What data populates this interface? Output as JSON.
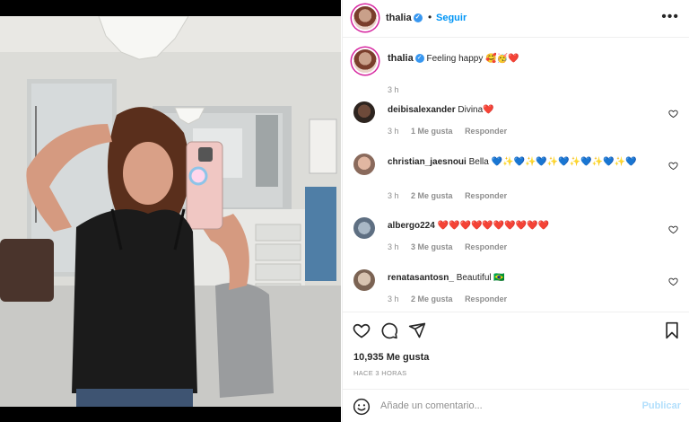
{
  "post_author": {
    "username": "thalia",
    "verified_icon": "verified-badge-icon",
    "follow_label": "Seguir",
    "dot": "•"
  },
  "caption": {
    "username": "thalia",
    "text": "Feeling happy 🥰🥳❤️",
    "time": "3 h"
  },
  "comments": [
    {
      "username": "deibisalexander",
      "text": "Divina❤️",
      "time": "3 h",
      "likes": "1 Me gusta",
      "reply": "Responder"
    },
    {
      "username": "christian_jaesnoui",
      "text": "Bella 💙✨💙✨💙✨💙✨💙✨💙✨💙",
      "time": "3 h",
      "likes": "2 Me gusta",
      "reply": "Responder"
    },
    {
      "username": "albergo224",
      "text": "❤️❤️❤️❤️❤️❤️❤️❤️❤️❤️",
      "time": "3 h",
      "likes": "3 Me gusta",
      "reply": "Responder"
    },
    {
      "username": "renatasantosn_",
      "text": "Beautiful 🇧🇷",
      "time": "3 h",
      "likes": "2 Me gusta",
      "reply": "Responder"
    }
  ],
  "actions": {
    "likes": "10,935 Me gusta",
    "ago": "HACE 3 HORAS"
  },
  "add_comment": {
    "placeholder": "Añade un comentario...",
    "publish": "Publicar"
  },
  "colors": {
    "accent": "#0095f6",
    "muted": "#8e8e8e",
    "publish_disabled": "#b2dffc",
    "story_ring": "#d6249f"
  }
}
